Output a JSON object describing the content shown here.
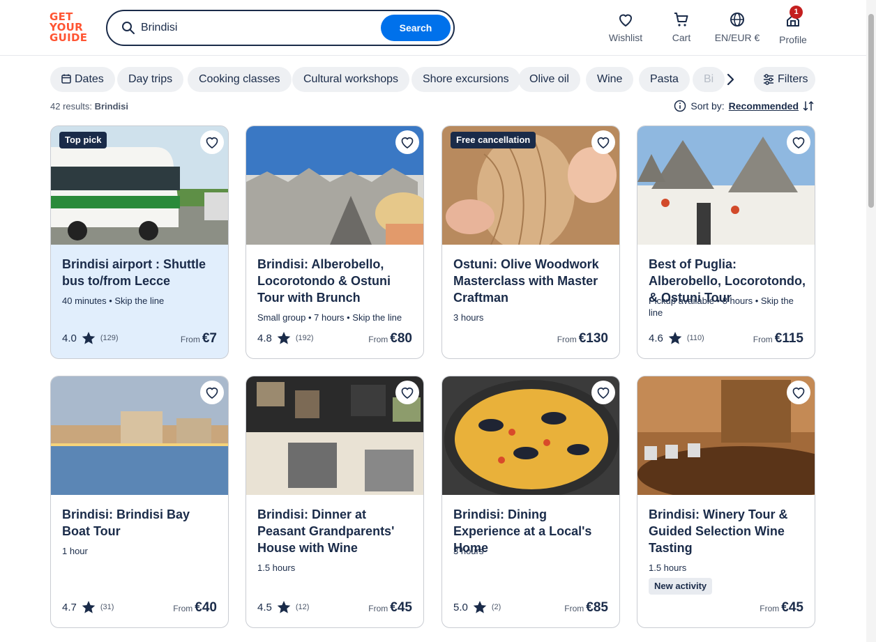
{
  "header": {
    "logo": [
      "GET",
      "YOUR",
      "GUIDE"
    ],
    "search_value": "Brindisi",
    "search_button": "Search",
    "nav": [
      {
        "label": "Wishlist",
        "icon": "heart-icon"
      },
      {
        "label": "Cart",
        "icon": "cart-icon"
      },
      {
        "label": "EN/EUR €",
        "icon": "globe-icon"
      },
      {
        "label": "Profile",
        "icon": "profile-icon",
        "badge": "1"
      }
    ]
  },
  "chips": [
    "Dates",
    "Day trips",
    "Cooking classes",
    "Cultural workshops",
    "Shore excursions",
    "Olive oil",
    "Wine",
    "Pasta",
    "Bi"
  ],
  "filters_label": "Filters",
  "results": {
    "count_text": "42 results:",
    "query": "Brindisi"
  },
  "sort": {
    "label": "Sort by:",
    "value": "Recommended"
  },
  "colors": {
    "brand": "#ff5533",
    "accent": "#0071eb",
    "navy": "#1a2b49",
    "highlight": "#e1eefc"
  },
  "cards": [
    {
      "tag": "Top pick",
      "title": "Brindisi airport : Shuttle bus to/from Lecce",
      "meta": "40 minutes • Skip the line",
      "rating": "4.0",
      "reviews": "(129)",
      "from": "From",
      "price": "€7"
    },
    {
      "tag": "",
      "title": "Brindisi: Alberobello, Locorotondo & Ostuni Tour with Brunch",
      "meta": "Small group • 7 hours • Skip the line",
      "rating": "4.8",
      "reviews": "(192)",
      "from": "From",
      "price": "€80"
    },
    {
      "tag": "Free cancellation",
      "title": "Ostuni: Olive Woodwork Masterclass with Master Craftman",
      "meta": "3 hours",
      "rating": "",
      "reviews": "",
      "from": "From",
      "price": "€130"
    },
    {
      "tag": "",
      "title": "Best of Puglia: Alberobello, Locorotondo, & Ostuni Tour",
      "meta": "Pickup available • 8 hours • Skip the line",
      "rating": "4.6",
      "reviews": "(110)",
      "from": "From",
      "price": "€115"
    },
    {
      "tag": "",
      "title": "Brindisi: Brindisi Bay Boat Tour",
      "meta": "1 hour",
      "rating": "4.7",
      "reviews": "(31)",
      "from": "From",
      "price": "€40"
    },
    {
      "tag": "",
      "title": "Brindisi: Dinner at Peasant Grandparents' House with Wine",
      "meta": "1.5 hours",
      "rating": "4.5",
      "reviews": "(12)",
      "from": "From",
      "price": "€45"
    },
    {
      "tag": "",
      "title": "Brindisi: Dining Experience at a Local's Home",
      "meta": "3 hours",
      "rating": "5.0",
      "reviews": "(2)",
      "from": "From",
      "price": "€85"
    },
    {
      "tag": "",
      "title": "Brindisi: Winery Tour & Guided Selection Wine Tasting",
      "meta": "1.5 hours",
      "new": "New activity",
      "rating": "",
      "reviews": "",
      "from": "From",
      "price": "€45"
    }
  ]
}
